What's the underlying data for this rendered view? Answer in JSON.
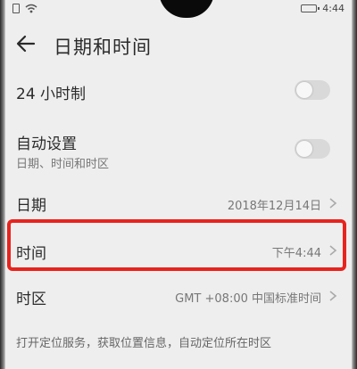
{
  "status_bar": {
    "time": "4:44"
  },
  "header": {
    "title": "日期和时间"
  },
  "settings": {
    "hour24": {
      "label": "24 小时制",
      "enabled": false
    },
    "auto": {
      "label": "自动设置",
      "sublabel": "日期、时间和时区",
      "enabled": false
    },
    "date": {
      "label": "日期",
      "value": "2018年12月14日"
    },
    "time": {
      "label": "时间",
      "value": "下午4:44"
    },
    "timezone": {
      "label": "时区",
      "value": "GMT +08:00 中国标准时间"
    }
  },
  "footer": {
    "text": "打开定位服务，获取位置信息，自动定位所在时区"
  },
  "colors": {
    "highlight": "#e8231d",
    "background": "#eeeeee"
  }
}
